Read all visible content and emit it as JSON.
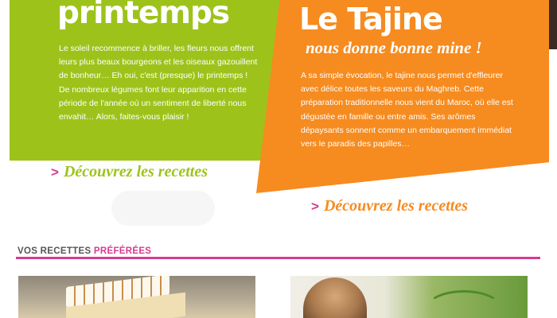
{
  "colors": {
    "spring_green": "#9dc31b",
    "tajine_orange": "#f68b1f",
    "accent_pink": "#d63a8f"
  },
  "spring": {
    "title": "printemps",
    "paragraph": "Le soleil recommence à briller, les fleurs nous offrent leurs plus beaux bourgeons et les oiseaux gazouillent de bonheur… Eh oui, c'est (presque) le printemps ! De nombreux légumes font leur apparition en cette période de l'année où un sentiment de liberté nous envahit… Alors, faites-vous plaisir !",
    "link_arrow": ">",
    "link_label": "Découvrez les recettes"
  },
  "tajine": {
    "title": "Le Tajine",
    "subtitle": "nous donne bonne mine !",
    "paragraph": "A sa simple évocation, le tajine nous permet d'effleurer avec délice toutes les saveurs du Maghreb. Cette préparation traditionnelle nous vient du Maroc, où elle est dégustée en famille ou entre amis. Ses arômes dépaysants sonnent comme un embarquement immédiat vers le paradis des papilles…",
    "link_arrow": ">",
    "link_label": "Découvrez les recettes"
  },
  "favorites": {
    "title_prefix": "VOS RECETTES",
    "title_highlight": "PRÉFÉRÉES"
  }
}
